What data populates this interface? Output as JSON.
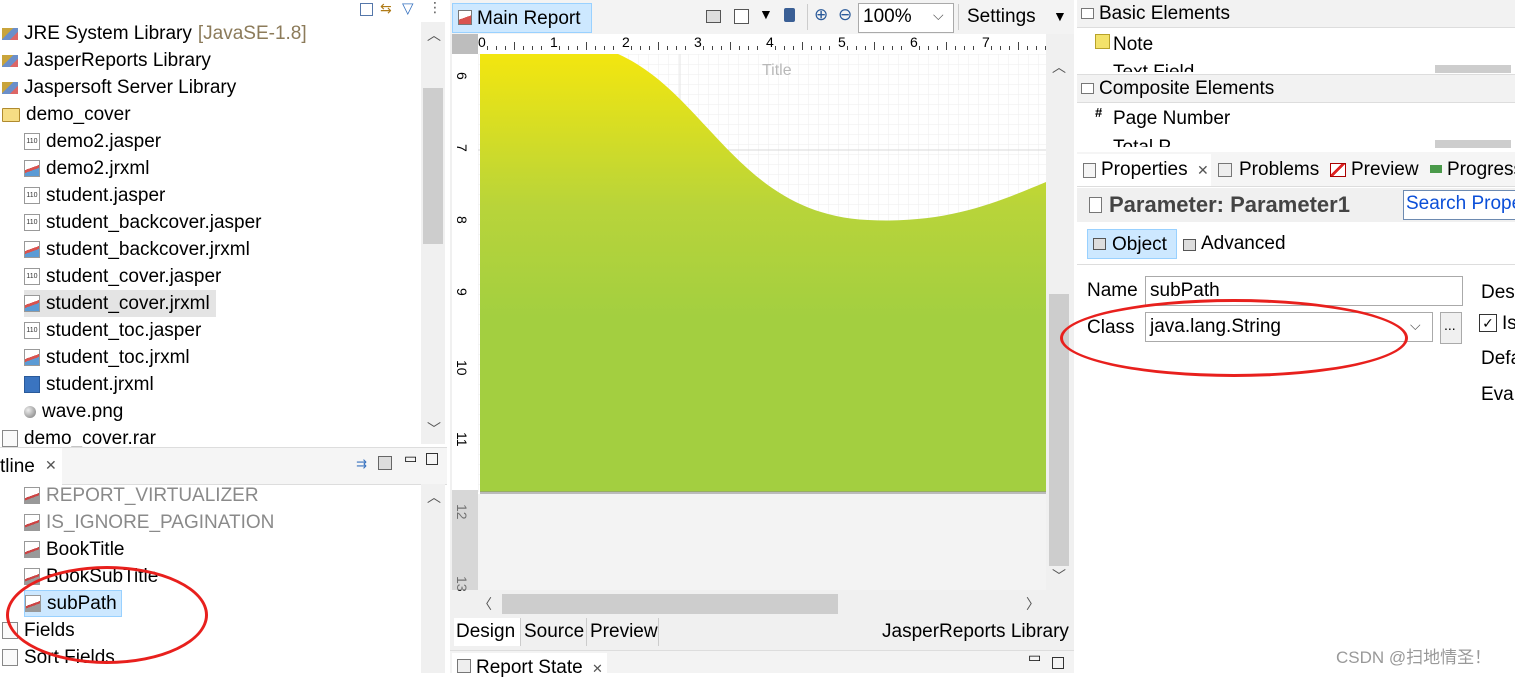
{
  "explorer": {
    "items": [
      {
        "label": "JRE System Library",
        "suffix": "[JavaSE-1.8]",
        "icon": "lib",
        "indent": 0
      },
      {
        "label": "JasperReports Library",
        "icon": "lib",
        "indent": 0
      },
      {
        "label": "Jaspersoft Server Library",
        "icon": "lib",
        "indent": 0
      },
      {
        "label": "demo_cover",
        "icon": "folder",
        "indent": 0
      },
      {
        "label": "demo2.jasper",
        "icon": "jasper",
        "indent": 1
      },
      {
        "label": "demo2.jrxml",
        "icon": "jrxml",
        "indent": 1
      },
      {
        "label": "student.jasper",
        "icon": "jasper",
        "indent": 1
      },
      {
        "label": "student_backcover.jasper",
        "icon": "jasper",
        "indent": 1
      },
      {
        "label": "student_backcover.jrxml",
        "icon": "jrxml",
        "indent": 1
      },
      {
        "label": "student_cover.jasper",
        "icon": "jasper",
        "indent": 1
      },
      {
        "label": "student_cover.jrxml",
        "icon": "jrxml",
        "indent": 1,
        "selected": true
      },
      {
        "label": "student_toc.jasper",
        "icon": "jasper",
        "indent": 1
      },
      {
        "label": "student_toc.jrxml",
        "icon": "jrxml",
        "indent": 1
      },
      {
        "label": "student.jrxml",
        "icon": "blue",
        "indent": 1
      },
      {
        "label": "wave.png",
        "icon": "png",
        "indent": 1
      },
      {
        "label": "demo_cover.rar",
        "icon": "doc",
        "indent": 0
      }
    ]
  },
  "outline": {
    "tab_label": "tline",
    "items": [
      {
        "label": "REPORT_VIRTUALIZER",
        "gray": true,
        "indent": 1
      },
      {
        "label": "IS_IGNORE_PAGINATION",
        "gray": true,
        "indent": 1
      },
      {
        "label": "BookTitle",
        "indent": 1
      },
      {
        "label": "BookSubTitle",
        "indent": 1
      },
      {
        "label": "subPath",
        "indent": 1,
        "selected": true
      },
      {
        "label": "Fields",
        "indent": 0
      },
      {
        "label": "Sort Fields",
        "indent": 0
      }
    ]
  },
  "editor": {
    "tab_label": "Main Report",
    "zoom": "100%",
    "settings_label": "Settings",
    "band_title": "Title",
    "ruler_top": [
      "0",
      "1",
      "2",
      "3",
      "4",
      "5",
      "6",
      "7"
    ],
    "ruler_left": [
      "6",
      "7",
      "8",
      "9",
      "10",
      "11",
      "12",
      "13"
    ],
    "bottom_tabs": [
      "Design",
      "Source",
      "Preview"
    ],
    "status_text": "JasperReports Library",
    "report_state_label": "Report State"
  },
  "palette": {
    "basic_header": "Basic Elements",
    "basic_items": [
      "Note",
      "Text Field"
    ],
    "composite_header": "Composite Elements",
    "composite_items": [
      "Page Number",
      "Total P"
    ]
  },
  "properties": {
    "tabs": [
      "Properties",
      "Problems",
      "Preview",
      "Progress"
    ],
    "title": "Parameter: Parameter1",
    "search_placeholder": "Search Properties",
    "subtabs": [
      "Object",
      "Advanced"
    ],
    "name_label": "Name",
    "name_value": "subPath",
    "class_label": "Class",
    "class_value": "java.lang.String",
    "browse_label": "...",
    "right_labels": [
      "Desc",
      "Is",
      "Defa",
      "Eval"
    ]
  },
  "watermark": "CSDN @扫地情圣！"
}
